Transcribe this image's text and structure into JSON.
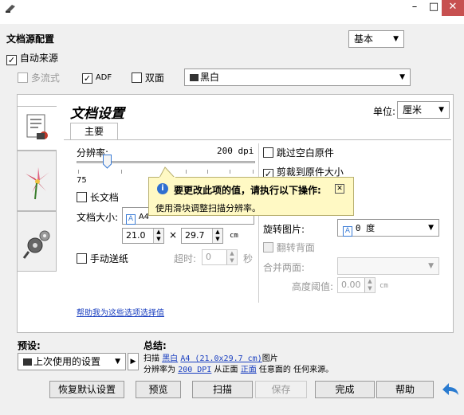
{
  "window": {
    "minimize": "–",
    "maximize": "□",
    "close": "✕"
  },
  "source": {
    "title": "文档源配置",
    "mode_select": "基本",
    "auto_source": "自动来源",
    "multistream": "多流式",
    "adf": "ADF",
    "duplex": "双面",
    "color_mode": "黑白"
  },
  "settings": {
    "title": "文档设置",
    "unit_label": "单位:",
    "unit_value": "厘米",
    "tab_main": "主要",
    "resolution_label": "分辨率:",
    "resolution_value": "200 dpi",
    "slider_min": "75",
    "slider_max": "1200",
    "slider_position": 0.17,
    "long_document": "长文档",
    "doc_size_label": "文档大小:",
    "doc_size_value": "A4",
    "width": "21.0",
    "times": "×",
    "height": "29.7",
    "size_unit": "cm",
    "manual_feed": "手动送纸",
    "timeout_label": "超时:",
    "timeout_value": "0",
    "timeout_unit": "秒",
    "skip_blank": "跳过空白原件",
    "crop_to_size": "剪裁到原件大小",
    "rotate_label": "旋转图片:",
    "rotate_value": "0 度",
    "flip_back": "翻转背面",
    "merge_label": "合并两面:",
    "threshold_label": "高度阈值:",
    "threshold_value": "0.00",
    "threshold_unit": "cm",
    "help_link": "帮助我为这些选项选择值"
  },
  "tooltip": {
    "title": "要更改此项的值，请执行以下操作:",
    "body": "使用滑块调整扫描分辨率。",
    "close": "✕"
  },
  "preset": {
    "label": "预设:",
    "value": "上次使用的设置"
  },
  "summary": {
    "label": "总结:",
    "l1_a": "扫描",
    "l1_color": "黑白",
    "l1_size": "A4 (21.0x29.7 cm)",
    "l1_b": "图片",
    "l2_a": "分辨率为",
    "l2_dpi": "200 DPI",
    "l2_b": "从正面",
    "l2_front": "正面",
    "l2_c": "任意面的 任何来源。"
  },
  "buttons": {
    "restore": "恢复默认设置",
    "preview": "预览",
    "scan": "扫描",
    "save": "保存",
    "done": "完成",
    "help": "帮助"
  }
}
